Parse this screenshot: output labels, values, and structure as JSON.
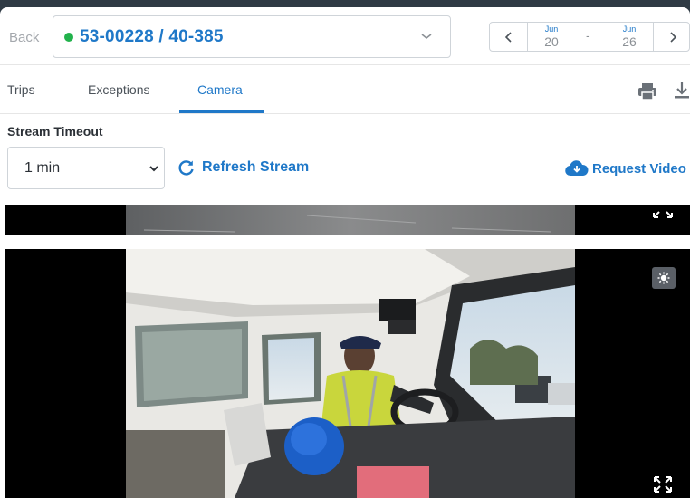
{
  "header": {
    "back_label": "Back",
    "vehicle": {
      "label": "53-00228 / 40-385",
      "status_color": "#22b24c"
    },
    "date_range": {
      "start": {
        "month": "Jun",
        "day": "20"
      },
      "separator": "-",
      "end": {
        "month": "Jun",
        "day": "26"
      }
    }
  },
  "tabs": [
    {
      "label": "Trips",
      "active": false
    },
    {
      "label": "Exceptions",
      "active": false
    },
    {
      "label": "Camera",
      "active": true
    }
  ],
  "toolbar_icons": [
    "print-icon",
    "download-icon"
  ],
  "controls": {
    "timeout_label": "Stream Timeout",
    "timeout_value": "1 min",
    "refresh_label": "Refresh Stream",
    "request_label": "Request Video"
  },
  "videos": [
    {
      "id": "video-tile-road",
      "icons": [
        "fullscreen-icon"
      ]
    },
    {
      "id": "video-tile-cab",
      "icons": [
        "brightness-icon",
        "fullscreen-icon"
      ]
    }
  ],
  "colors": {
    "accent": "#1f78c8",
    "status_online": "#22b24c",
    "text_muted": "#a4a8ad"
  }
}
